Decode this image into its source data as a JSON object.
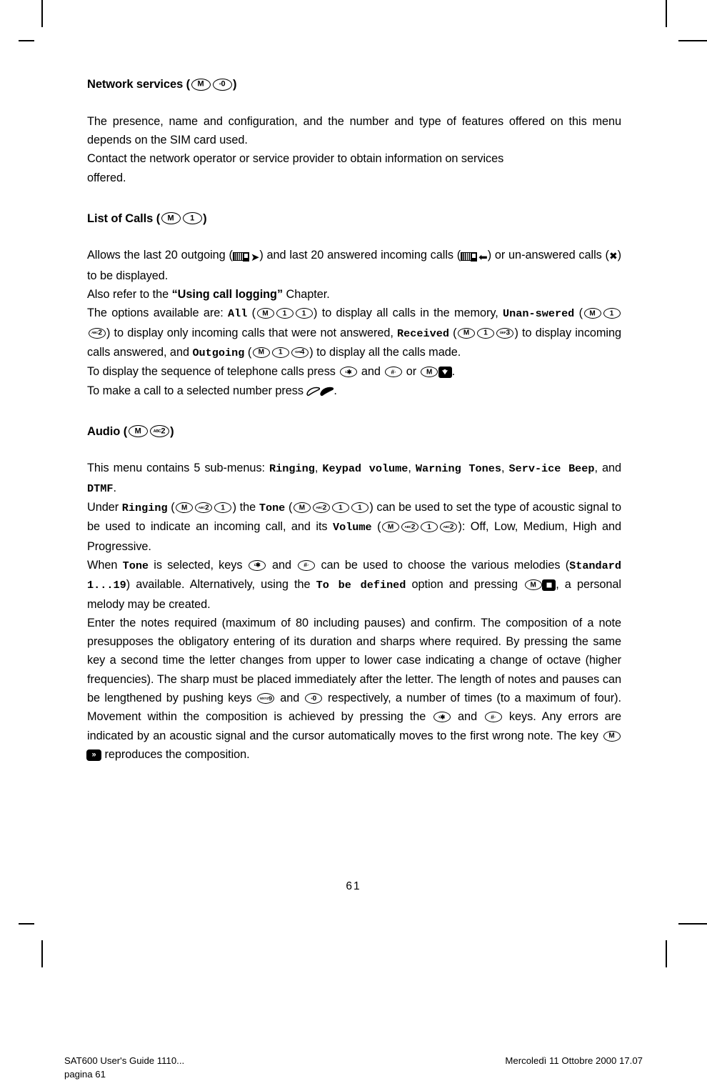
{
  "document": {
    "page_number": "61",
    "footer": {
      "left_line1": "SAT600 User's Guide 1110...",
      "left_line2": "pagina 61",
      "right": "Mercoledì 11 Ottobre 2000 17.07"
    }
  },
  "sections": [
    {
      "id": "network-services",
      "heading_text": "Network services (",
      "heading_close": ")",
      "keys": [
        {
          "pre": "",
          "main": "M"
        },
        {
          "pre": "+",
          "main": "0"
        }
      ]
    },
    {
      "id": "list-of-calls",
      "heading_text": "List of Calls (",
      "heading_close": ")",
      "keys": [
        {
          "pre": "",
          "main": "M"
        },
        {
          "pre": "",
          "main": "1"
        }
      ]
    },
    {
      "id": "audio",
      "heading_text": "Audio (",
      "heading_close": ")",
      "keys": [
        {
          "pre": "",
          "main": "M"
        },
        {
          "pre": "ABC",
          "main": "2"
        }
      ]
    }
  ],
  "network_services": {
    "p1_a": "The presence, name and configuration, and the number and type of features offered on this menu depends on the SIM card used.",
    "p2_a": "Contact the network operator or service provider to obtain information on services",
    "p2_b": "offered."
  },
  "list_of_calls": {
    "t1": "Allows the last 20 outgoing (",
    "t2": ") and last 20 answered incoming calls (",
    "t3": ") or un-answered calls (",
    "t4": ") to be displayed.",
    "t5": "Also refer to the ",
    "t5_bold": "“Using call logging”",
    "t6": " Chapter.",
    "t7": "The options available are: ",
    "opt_all": "All",
    "t8": " (",
    "t9": ") to display all calls in the memory, ",
    "opt_unanswered": "Unan-swered",
    "t10": " (",
    "t11": ") to display only incoming calls that were not answered, ",
    "opt_received": "Received",
    "t12": " (",
    "t13": ") to display incoming calls answered, and ",
    "opt_outgoing": "Outgoing",
    "t14": " (",
    "t15": ") to display all the calls made.",
    "t16": "To display the sequence of telephone calls press ",
    "t17": " and ",
    "t18": " or ",
    "t19": ".",
    "t20": "To make a call to a selected number press ",
    "t21": "."
  },
  "audio": {
    "t1": "This menu contains 5 sub-menus: ",
    "sub1": "Ringing",
    "c1": ", ",
    "sub2": "Keypad volume",
    "c2": ", ",
    "sub3": "Warning Tones",
    "c3": ", ",
    "sub4": "Serv-ice Beep",
    "c4": ", and ",
    "sub5": "DTMF",
    "c5": ".",
    "t2": "Under ",
    "m_ringing": "Ringing",
    "t3": " (",
    "t4": ") the ",
    "m_tone": "Tone",
    "t5": " (",
    "t6": ") can be used to set the type of acoustic signal to be used to indicate an incoming call, and its ",
    "m_volume": "Volume",
    "t7": " (",
    "t8": "): Off, Low, Medium, High and Progressive.",
    "t9": "When ",
    "m_tone2": "Tone",
    "t10": " is selected, keys ",
    "t11": " and ",
    "t12": " can be used to choose the various melodies (",
    "m_standard": "Standard 1...19",
    "t13": ") available. Alternatively, using the ",
    "m_tobedefined": "To be defined",
    "t14": " option and pressing ",
    "t15": ", a personal melody may be created.",
    "t16": "Enter the notes required (maximum of 80 including pauses) and confirm. The composition of a note presupposes the obligatory entering of its duration and sharps where required. By pressing the same key a second time the letter changes from upper to lower case indicating a change of octave (higher frequencies). The sharp must be placed immediately after the letter. The length of notes and pauses can be lengthened by pushing keys ",
    "t17": " and ",
    "t18": " respectively, a number of times (to a maximum of four). Movement within the composition is achieved by pressing the ",
    "t19": " and ",
    "t20": " keys. Any errors are indicated by an acoustic signal and the cursor automatically moves to the first wrong note. The key ",
    "t21": " reproduces the composition."
  },
  "keypad": {
    "m": {
      "pre": "",
      "main": "M"
    },
    "zero": {
      "pre": "+",
      "main": "0"
    },
    "one": {
      "pre": "",
      "main": "1"
    },
    "two": {
      "pre": "ABC",
      "main": "2"
    },
    "three": {
      "pre": "DEF",
      "main": "3"
    },
    "four": {
      "pre": "GHI",
      "main": "4"
    },
    "nine": {
      "pre": "WXYZ",
      "main": "9"
    },
    "star": {
      "pre": "1",
      "main": "✱"
    },
    "hash": {
      "pre": "#",
      "main": "♪"
    }
  },
  "pictograms": {
    "outgoing_call": "phone-arrow-right-icon",
    "incoming_call": "phone-arrow-left-icon",
    "missed_call": "✖",
    "arrow_right": "➜",
    "arrow_left": "⬅",
    "send_key": "handset-outline-icon",
    "end_key": "handset-filled-icon",
    "soft_stop": "stop-square-icon",
    "soft_down": "down-arrow-icon",
    "soft_play": "»"
  },
  "colors": {
    "ink": "#000000",
    "paper": "#ffffff"
  }
}
